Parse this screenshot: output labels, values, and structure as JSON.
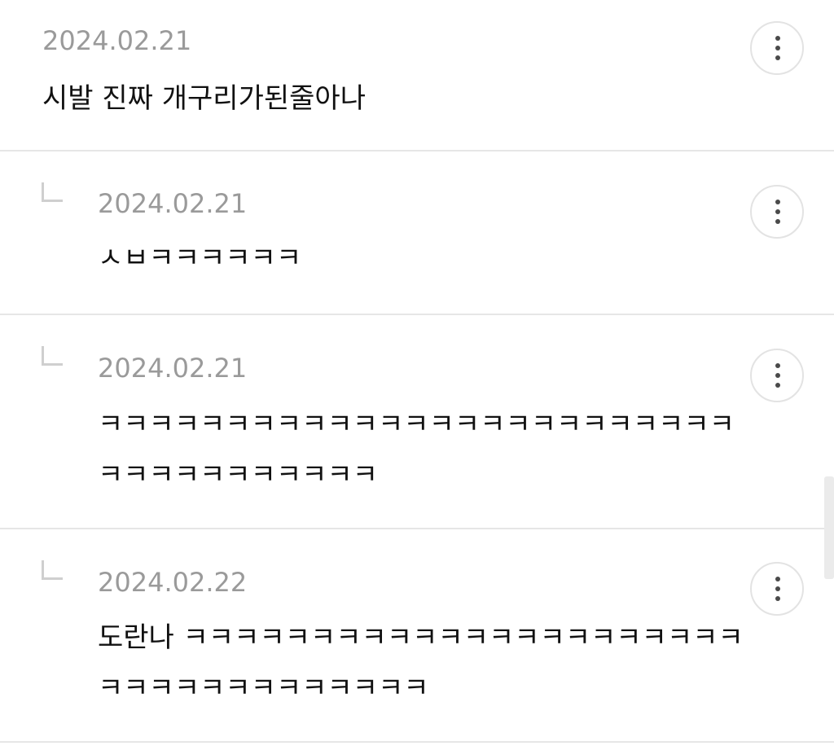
{
  "comments": [
    {
      "date": "2024.02.21",
      "text": "시발 진짜 개구리가된줄아나",
      "is_reply": false,
      "more_icon": "more-vertical-icon"
    },
    {
      "date": "2024.02.21",
      "text": "ㅅㅂㅋㅋㅋㅋㅋㅋ",
      "is_reply": true,
      "reply_icon": "reply-arrow-icon",
      "more_icon": "more-vertical-icon"
    },
    {
      "date": "2024.02.21",
      "text": "ㅋㅋㅋㅋㅋㅋㅋㅋㅋㅋㅋㅋㅋㅋㅋㅋㅋㅋㅋㅋㅋㅋㅋㅋㅋㅋㅋㅋㅋㅋㅋㅋㅋㅋㅋㅋ",
      "is_reply": true,
      "reply_icon": "reply-arrow-icon",
      "more_icon": "more-vertical-icon"
    },
    {
      "date": "2024.02.22",
      "text": "도란나 ㅋㅋㅋㅋㅋㅋㅋㅋㅋㅋㅋㅋㅋㅋㅋㅋㅋㅋㅋㅋㅋㅋㅋㅋㅋㅋㅋㅋㅋㅋㅋㅋㅋㅋㅋ",
      "is_reply": true,
      "reply_icon": "reply-arrow-icon",
      "more_icon": "more-vertical-icon"
    }
  ]
}
